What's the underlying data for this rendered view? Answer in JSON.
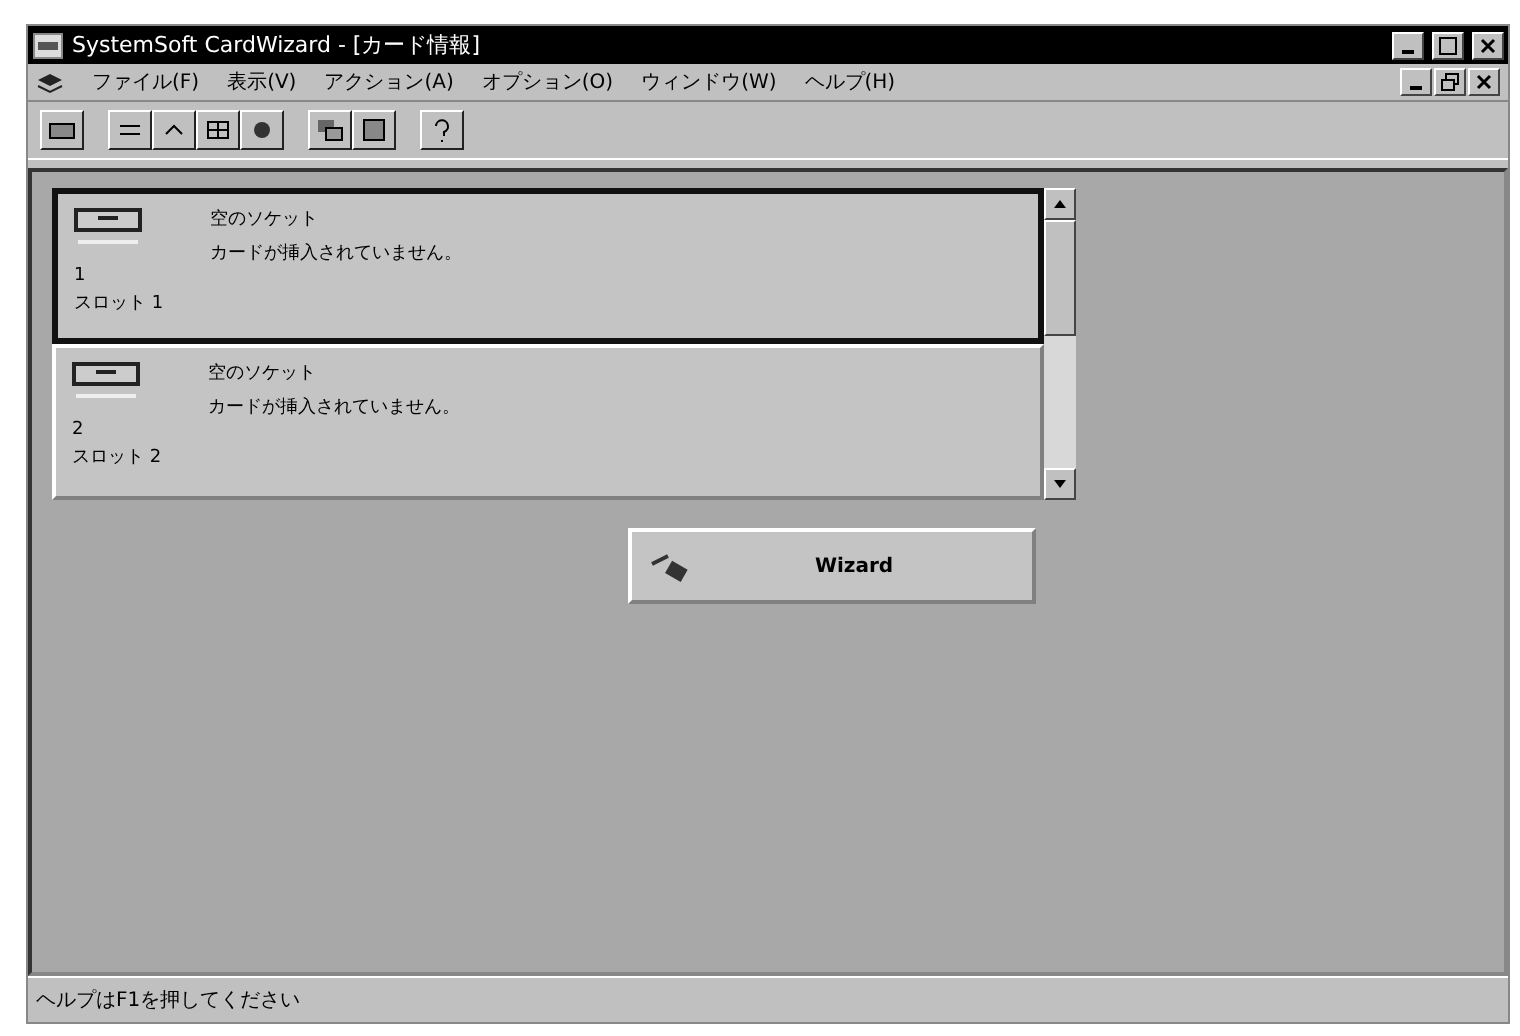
{
  "window": {
    "title": "SystemSoft CardWizard - [カード情報]"
  },
  "menu": [
    "ファイル(F)",
    "表示(V)",
    "アクション(A)",
    "オプション(O)",
    "ウィンドウ(W)",
    "ヘルプ(H)"
  ],
  "slots": [
    {
      "status": "空のソケット",
      "message": "カードが挿入されていません。",
      "number": "1",
      "label": "スロット 1",
      "selected": true
    },
    {
      "status": "空のソケット",
      "message": "カードが挿入されていません。",
      "number": "2",
      "label": "スロット 2",
      "selected": false
    }
  ],
  "wizard_button": "Wizard",
  "status_bar": "ヘルプはF1を押してください"
}
